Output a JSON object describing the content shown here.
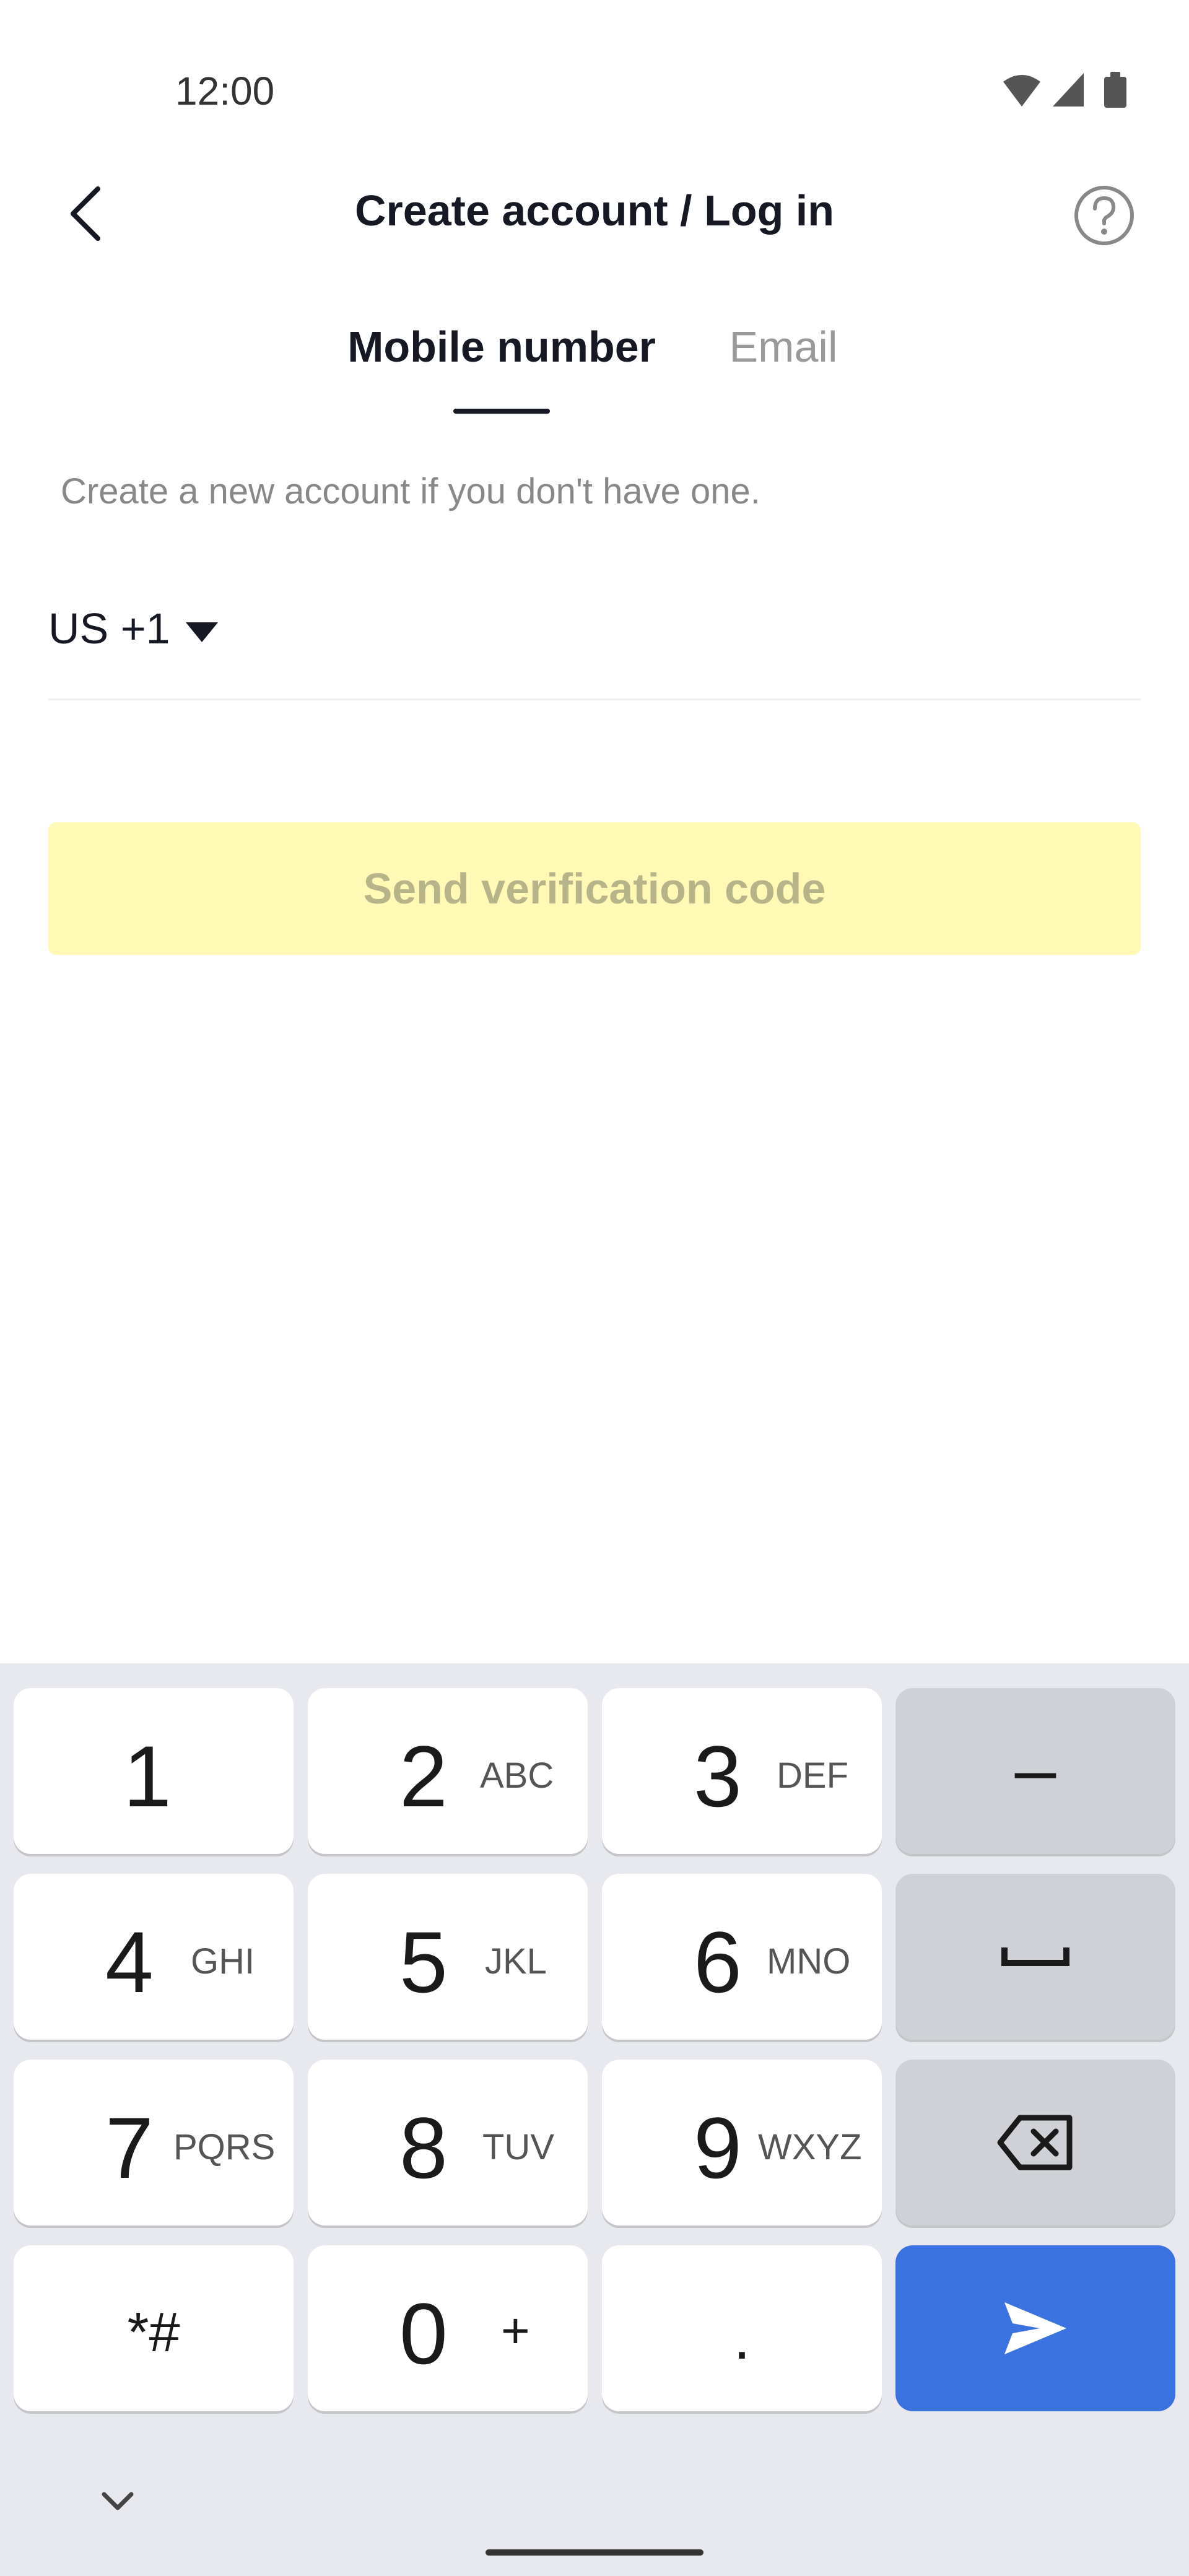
{
  "status_bar": {
    "time": "12:00",
    "icons": [
      "wifi-icon",
      "cellular-icon",
      "battery-icon"
    ]
  },
  "header": {
    "title": "Create account / Log in",
    "back_icon": "chevron-left-icon",
    "help_icon": "help-circle-icon"
  },
  "tabs": [
    {
      "label": "Mobile number",
      "active": true
    },
    {
      "label": "Email",
      "active": false
    }
  ],
  "helper_text": "Create a new account if you don't have one.",
  "phone_field": {
    "country_code": "US +1",
    "value": "",
    "placeholder": ""
  },
  "send_button": {
    "label": "Send verification code",
    "enabled": false
  },
  "keyboard": {
    "keys": [
      {
        "digit": "1",
        "letters": ""
      },
      {
        "digit": "2",
        "letters": "ABC"
      },
      {
        "digit": "3",
        "letters": "DEF"
      },
      {
        "digit": "4",
        "letters": "GHI"
      },
      {
        "digit": "5",
        "letters": "JKL"
      },
      {
        "digit": "6",
        "letters": "MNO"
      },
      {
        "digit": "7",
        "letters": "PQRS"
      },
      {
        "digit": "8",
        "letters": "TUV"
      },
      {
        "digit": "9",
        "letters": "WXYZ"
      },
      {
        "digit": "*#",
        "letters": ""
      },
      {
        "digit": "0",
        "letters": "+"
      },
      {
        "digit": ".",
        "letters": ""
      }
    ],
    "function_keys": [
      "minus-key",
      "space-key",
      "backspace-key",
      "send-key"
    ],
    "minus_symbol": "–"
  },
  "colors": {
    "send_button_bg": "#fff9b5",
    "send_button_text": "#b8b48a",
    "send_key": "#3a73df",
    "keyboard_bg": "#e8e9ee"
  }
}
